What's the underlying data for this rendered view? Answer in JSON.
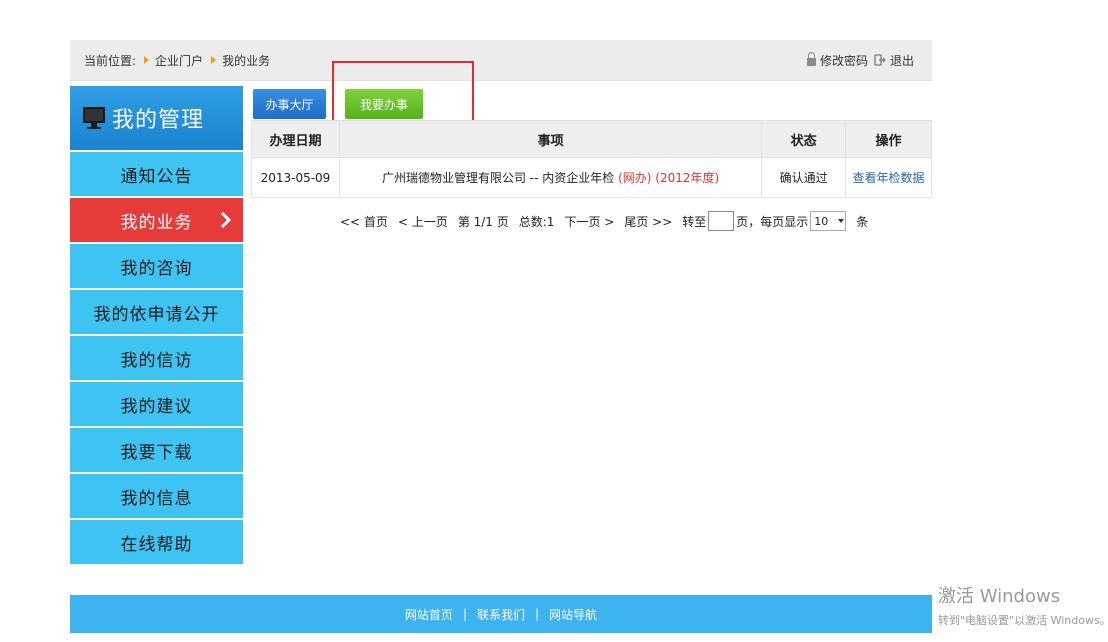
{
  "breadcrumb": {
    "prefix": "当前位置:",
    "items": [
      "企业门户",
      "我的业务"
    ]
  },
  "top_links": {
    "change_password": "修改密码",
    "logout": "退出"
  },
  "sidebar": {
    "title": "我的管理",
    "items": [
      {
        "label": "通知公告"
      },
      {
        "label": "我的业务",
        "active": true
      },
      {
        "label": "我的咨询"
      },
      {
        "label": "我的依申请公开"
      },
      {
        "label": "我的信访"
      },
      {
        "label": "我的建议"
      },
      {
        "label": "我要下载"
      },
      {
        "label": "我的信息"
      },
      {
        "label": "在线帮助"
      }
    ]
  },
  "buttons": {
    "hall": "办事大厅",
    "mine": "我要办事"
  },
  "table": {
    "headers": [
      "办理日期",
      "事项",
      "状态",
      "操作"
    ],
    "rows": [
      {
        "date": "2013-05-09",
        "item_prefix": "广州瑞德物业管理有限公司 -- 内资企业年检",
        "item_mode": "(网办)",
        "item_year": "(2012年度)",
        "status": "确认通过",
        "action": "查看年检数据"
      }
    ]
  },
  "pager": {
    "first": "<< 首页",
    "prev": "< 上一页",
    "page_info": "第 1/1 页",
    "total": "总数:1",
    "next": "下一页 >",
    "last": "尾页 >>",
    "goto_prefix": "转至",
    "goto_suffix": "页，每页显示",
    "page_size": "10",
    "unit": "条"
  },
  "footer": {
    "links": [
      "网站首页",
      "联系我们",
      "网站导航"
    ],
    "separator": "|"
  },
  "watermark": {
    "title": "激活 Windows",
    "subtitle": "转到\"电脑设置\"以激活 Windows。"
  }
}
